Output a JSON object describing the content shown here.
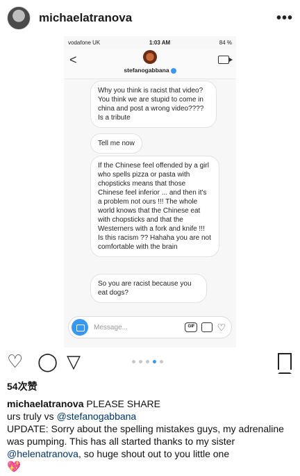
{
  "post": {
    "username": "michaelatranova",
    "more_icon": "•••"
  },
  "screenshot": {
    "status": {
      "carrier": "vodafone UK",
      "time": "1:03 AM",
      "battery": "84 %"
    },
    "chat": {
      "back_icon": "<",
      "name": "stefanogabbana",
      "messages": [
        "Why you think is racist that video? You think we are stupid to come in china and post a wrong video???? Is a tribute",
        "Tell me now",
        "If the Chinese feel offended by a girl who spells pizza or pasta with chopsticks means that those Chinese feel inferior ... and then it's a problem not ours  !!! The whole world knows that the Chinese eat with chopsticks and that the Westerners with a fork and knife !!! Is this racism ?? Hahaha you are not comfortable with the brain",
        "So you are racist because you eat dogs?"
      ],
      "input_placeholder": "Message...",
      "gif_label": "GIF"
    }
  },
  "actions": {
    "heart_icon": "♡",
    "comment_icon": "◯",
    "share_icon": "▽"
  },
  "likes": "54次赞",
  "caption": {
    "user": "michaelatranova",
    "text1": "PLEASE SHARE",
    "line2_prefix": "urs truly vs ",
    "line2_mention": "@stefanogabbana",
    "update_text": "UPDATE: Sorry about the spelling mistakes guys, my adrenaline was pumping. This has all started thanks to my sister ",
    "update_mention": "@helenatranova",
    "update_end": ", so huge shout out to you little one",
    "emoji": "💖"
  },
  "colors": {
    "accent": "#3897f0",
    "mention": "#003569"
  }
}
